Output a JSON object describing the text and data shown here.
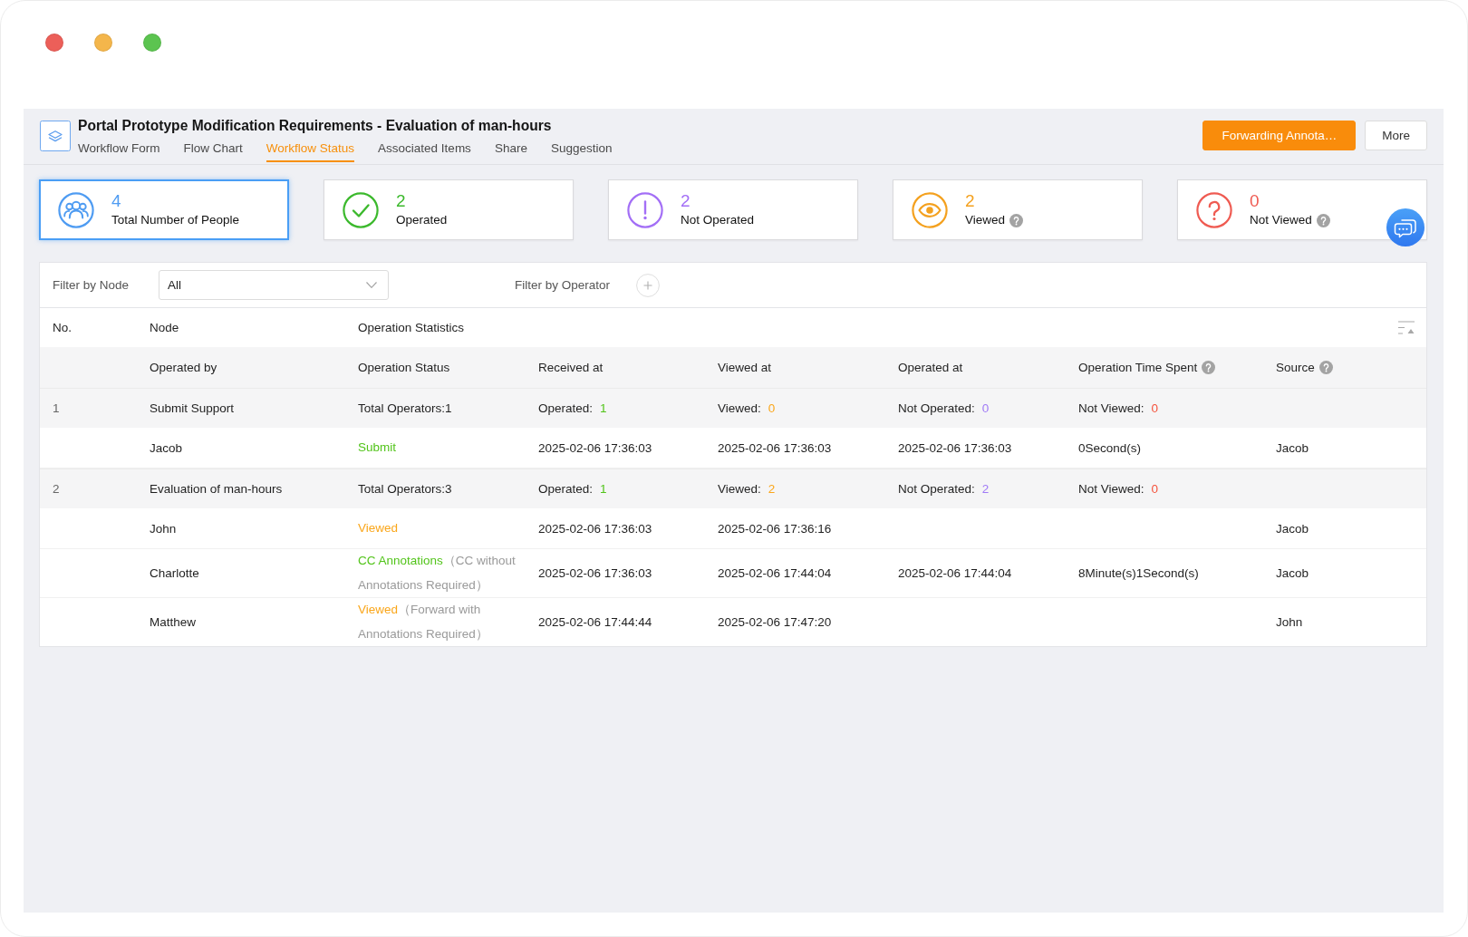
{
  "window_controls": [
    {
      "color": "#ec5f59"
    },
    {
      "color": "#f4b64b"
    },
    {
      "color": "#5cc450"
    }
  ],
  "header": {
    "title": "Portal Prototype Modification Requirements - Evaluation of man-hours",
    "tabs": [
      {
        "label": "Workflow Form",
        "selected": false
      },
      {
        "label": "Flow Chart",
        "selected": false
      },
      {
        "label": "Workflow Status",
        "selected": true
      },
      {
        "label": "Associated Items",
        "selected": false
      },
      {
        "label": "Share",
        "selected": false
      },
      {
        "label": "Suggestion",
        "selected": false
      }
    ],
    "buttons": [
      {
        "label": "Forwarding Annota…",
        "kind": "primary"
      },
      {
        "label": "More",
        "kind": "default"
      }
    ]
  },
  "stats": [
    {
      "kind": "people",
      "value": "4",
      "label": "Total Number of People",
      "color": "#4f9cf2",
      "help": false,
      "selected": true
    },
    {
      "kind": "check",
      "value": "2",
      "label": "Operated",
      "color": "#3cb92d",
      "help": false,
      "selected": false
    },
    {
      "kind": "alert",
      "value": "2",
      "label": "Not Operated",
      "color": "#a36ff6",
      "help": false,
      "selected": false
    },
    {
      "kind": "eye",
      "value": "2",
      "label": "Viewed",
      "color": "#f4a11f",
      "help": true,
      "selected": false
    },
    {
      "kind": "question",
      "value": "0",
      "label": "Not Viewed",
      "color": "#ef5b52",
      "help": true,
      "selected": false
    }
  ],
  "filters": {
    "node_label": "Filter by Node",
    "node_value": "All",
    "operator_label": "Filter by Operator"
  },
  "table": {
    "columns": [
      {
        "label": "No."
      },
      {
        "label": "Node"
      },
      {
        "label": "Operation Statistics"
      }
    ],
    "subcolumns": [
      {
        "label": "Operated by",
        "help": false
      },
      {
        "label": "Operation Status",
        "help": false
      },
      {
        "label": "Received at",
        "help": false
      },
      {
        "label": "Viewed at",
        "help": false
      },
      {
        "label": "Operated at",
        "help": false
      },
      {
        "label": "Operation Time Spent",
        "help": true
      },
      {
        "label": "Source",
        "help": true
      }
    ],
    "rows": [
      {
        "no": "1",
        "node": "Submit Support",
        "total": "Total Operators:1",
        "counts": [
          {
            "label": "Operated:",
            "value": "1",
            "color": "#52c41a"
          },
          {
            "label": "Viewed:",
            "value": "0",
            "color": "#faa61a"
          },
          {
            "label": "Not Operated:",
            "value": "0",
            "color": "#a07af6"
          },
          {
            "label": "Not Viewed:",
            "value": "0",
            "color": "#f5533d"
          }
        ],
        "operators": [
          {
            "name": "Jacob",
            "status": {
              "text": "Submit",
              "color": "#52c41a"
            },
            "received_at": "2025-02-06 17:36:03",
            "viewed_at": "2025-02-06 17:36:03",
            "operated_at": "2025-02-06 17:36:03",
            "time_spent": "0Second(s)",
            "source": "Jacob"
          }
        ]
      },
      {
        "no": "2",
        "node": "Evaluation of man-hours",
        "total": "Total Operators:3",
        "counts": [
          {
            "label": "Operated:",
            "value": "1",
            "color": "#52c41a"
          },
          {
            "label": "Viewed:",
            "value": "2",
            "color": "#faa61a"
          },
          {
            "label": "Not Operated:",
            "value": "2",
            "color": "#a07af6"
          },
          {
            "label": "Not Viewed:",
            "value": "0",
            "color": "#f5533d"
          }
        ],
        "operators": [
          {
            "name": "John",
            "status": {
              "text": "Viewed",
              "color": "#faa61a"
            },
            "received_at": "2025-02-06 17:36:03",
            "viewed_at": "2025-02-06 17:36:16",
            "source": "Jacob"
          },
          {
            "name": "Charlotte",
            "status": {
              "text": "CC Annotations",
              "color": "#52c41a"
            },
            "note": "（CC without Annotations Required）",
            "received_at": "2025-02-06 17:36:03",
            "viewed_at": "2025-02-06 17:44:04",
            "operated_at": "2025-02-06 17:44:04",
            "time_spent": "8Minute(s)1Second(s)",
            "source": "Jacob"
          },
          {
            "name": "Matthew",
            "status": {
              "text": "Viewed",
              "color": "#faa61a"
            },
            "note": "（Forward with Annotations Required）",
            "received_at": "2025-02-06 17:44:44",
            "viewed_at": "2025-02-06 17:47:20",
            "source": "John"
          }
        ]
      }
    ]
  }
}
